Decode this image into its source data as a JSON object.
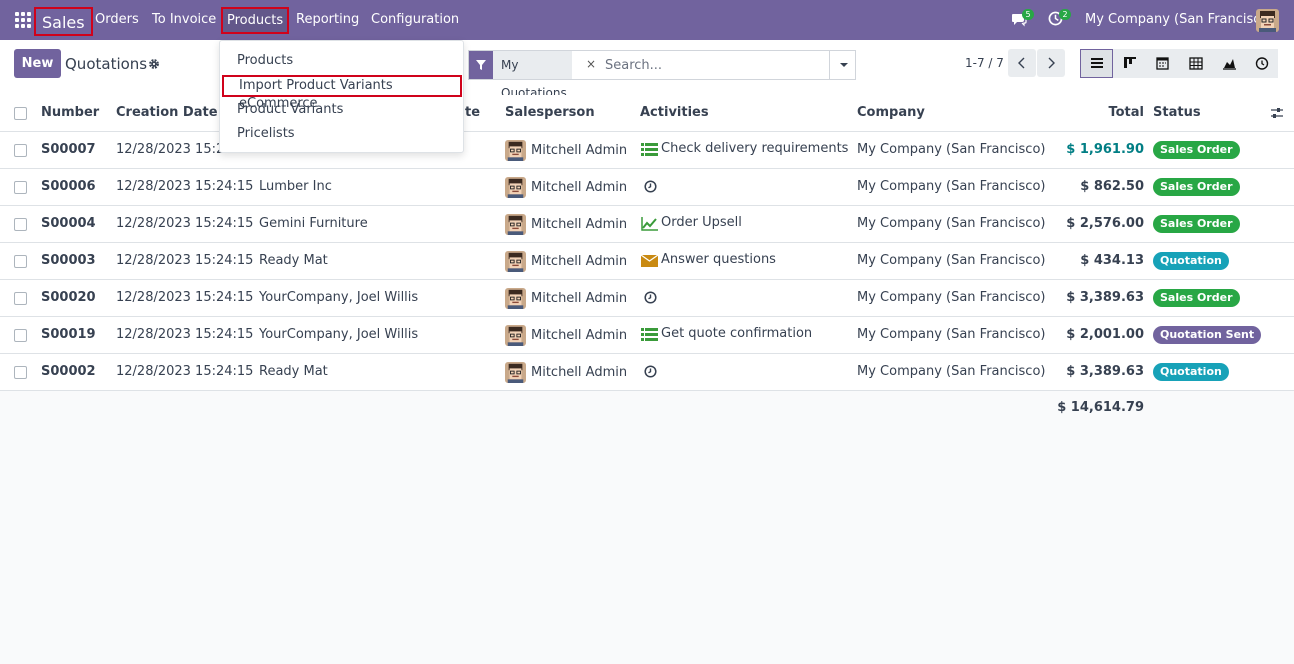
{
  "navbar": {
    "brand": "Sales",
    "menu": [
      "Orders",
      "To Invoice",
      "Products",
      "Reporting",
      "Configuration"
    ],
    "messages_count": "5",
    "activities_count": "2",
    "company": "My Company (San Francisco)",
    "icons": [
      "apps-grid-icon",
      "chat-icon",
      "clock-icon",
      "user-avatar"
    ],
    "colors": {
      "primary": "#71639e",
      "highlight_border": "#d0021b"
    }
  },
  "control_panel": {
    "new_label": "New",
    "title": "Quotations",
    "facet_label": "My Quotations",
    "facet_close": "×",
    "search_placeholder": "Search...",
    "pager": "1-7 / 7",
    "views": [
      "list-view-icon",
      "kanban-view-icon",
      "calendar-view-icon",
      "pivot-view-icon",
      "graph-view-icon",
      "activity-view-icon"
    ],
    "active_view": "list-view-icon"
  },
  "products_menu": {
    "items": [
      "Products",
      "Import Product Variants eCommerce",
      "Product Variants",
      "Pricelists"
    ],
    "highlighted": "Import Product Variants eCommerce"
  },
  "table": {
    "headers": {
      "number": "Number",
      "creation_date": "Creation Date",
      "customer_partial": "te",
      "salesperson": "Salesperson",
      "activities": "Activities",
      "company": "Company",
      "total": "Total",
      "status": "Status"
    },
    "rows": [
      {
        "number": "S00007",
        "date": "12/28/2023 15:24",
        "customer": "",
        "salesperson": "Mitchell Admin",
        "activity": "Check delivery requirements",
        "activity_icon": "list-icon",
        "company": "My Company (San Francisco)",
        "total": "$ 1,961.90",
        "status": "Sales Order"
      },
      {
        "number": "S00006",
        "date": "12/28/2023 15:24:15",
        "customer": "Lumber Inc",
        "salesperson": "Mitchell Admin",
        "activity": "",
        "activity_icon": "clock-icon",
        "company": "My Company (San Francisco)",
        "total": "$ 862.50",
        "status": "Sales Order"
      },
      {
        "number": "S00004",
        "date": "12/28/2023 15:24:15",
        "customer": "Gemini Furniture",
        "salesperson": "Mitchell Admin",
        "activity": "Order Upsell",
        "activity_icon": "trend-up-icon",
        "company": "My Company (San Francisco)",
        "total": "$ 2,576.00",
        "status": "Sales Order"
      },
      {
        "number": "S00003",
        "date": "12/28/2023 15:24:15",
        "customer": "Ready Mat",
        "salesperson": "Mitchell Admin",
        "activity": "Answer questions",
        "activity_icon": "envelope-icon",
        "company": "My Company (San Francisco)",
        "total": "$ 434.13",
        "status": "Quotation"
      },
      {
        "number": "S00020",
        "date": "12/28/2023 15:24:15",
        "customer": "YourCompany, Joel Willis",
        "salesperson": "Mitchell Admin",
        "activity": "",
        "activity_icon": "clock-icon",
        "company": "My Company (San Francisco)",
        "total": "$ 3,389.63",
        "status": "Sales Order"
      },
      {
        "number": "S00019",
        "date": "12/28/2023 15:24:15",
        "customer": "YourCompany, Joel Willis",
        "salesperson": "Mitchell Admin",
        "activity": "Get quote confirmation",
        "activity_icon": "list-icon",
        "company": "My Company (San Francisco)",
        "total": "$ 2,001.00",
        "status": "Quotation Sent"
      },
      {
        "number": "S00002",
        "date": "12/28/2023 15:24:15",
        "customer": "Ready Mat",
        "salesperson": "Mitchell Admin",
        "activity": "",
        "activity_icon": "clock-icon",
        "company": "My Company (San Francisco)",
        "total": "$ 3,389.63",
        "status": "Quotation"
      }
    ],
    "grand_total": "$ 14,614.79",
    "status_colors": {
      "Sales Order": "#28a745",
      "Quotation": "#17a2b8",
      "Quotation Sent": "#71639e"
    }
  }
}
